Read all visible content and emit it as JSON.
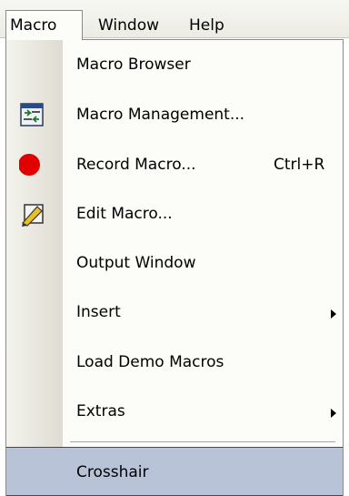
{
  "menubar": {
    "items": [
      {
        "label": "Macro"
      },
      {
        "label": "Window"
      },
      {
        "label": "Help"
      }
    ]
  },
  "menu": {
    "items": [
      {
        "label": "Macro Browser",
        "shortcut": "",
        "submenu": false,
        "icon": ""
      },
      {
        "label": "Macro Management...",
        "shortcut": "",
        "submenu": false,
        "icon": "macro-management-icon"
      },
      {
        "label": "Record Macro...",
        "shortcut": "Ctrl+R",
        "submenu": false,
        "icon": "record-icon"
      },
      {
        "label": "Edit Macro...",
        "shortcut": "",
        "submenu": false,
        "icon": "edit-pencil-icon"
      },
      {
        "label": "Output Window",
        "shortcut": "",
        "submenu": false,
        "icon": ""
      },
      {
        "label": "Insert",
        "shortcut": "",
        "submenu": true,
        "icon": ""
      },
      {
        "label": "Load Demo Macros",
        "shortcut": "",
        "submenu": false,
        "icon": ""
      },
      {
        "label": "Extras",
        "shortcut": "",
        "submenu": true,
        "icon": ""
      },
      {
        "label": "Crosshair",
        "shortcut": "",
        "submenu": false,
        "icon": "",
        "selected": true
      }
    ]
  },
  "colors": {
    "selection": "#b8c3d8",
    "record": "#e00000"
  }
}
